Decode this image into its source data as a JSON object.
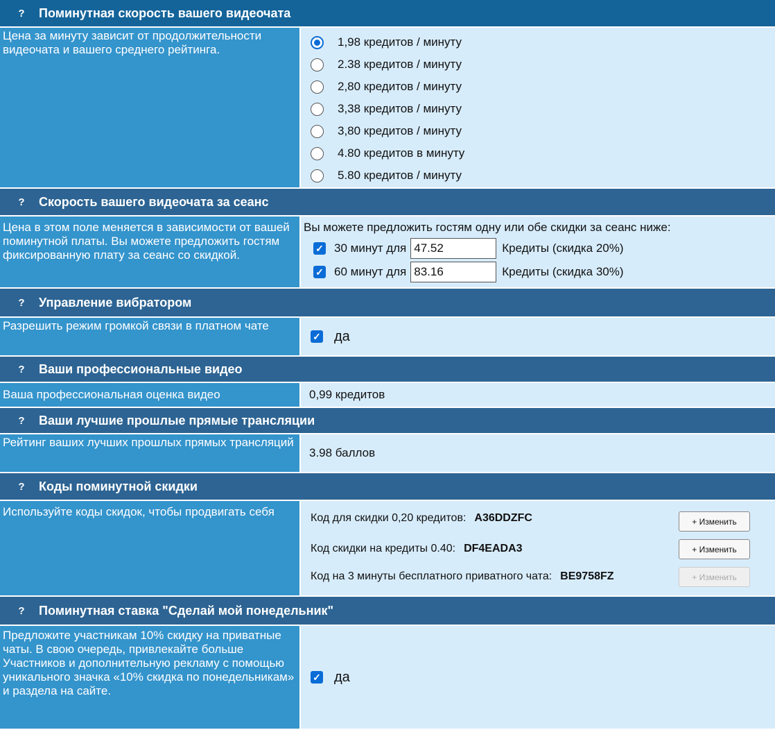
{
  "sections": {
    "rate": {
      "title": "Поминутная скорость вашего видеочата",
      "desc": "Цена за минуту зависит от продолжительности видеочата и вашего среднего рейтинга.",
      "options": [
        "1,98 кредитов / минуту",
        "2.38 кредитов / минуту",
        "2,80 кредитов / минуту",
        "3,38 кредитов / минуту",
        "3,80 кредитов / минуту",
        "4.80 кредитов в минуту",
        "5.80 кредитов / минуту"
      ],
      "selected_index": 0
    },
    "session": {
      "title": "Скорость вашего видеочата за сеанс",
      "desc": "Цена в этом поле меняется в зависимости от вашей поминутной платы. Вы можете предложить гостям фиксированную плату за сеанс со скидкой.",
      "intro": "Вы можете предложить гостям одну или обе скидки за сеанс ниже:",
      "items": [
        {
          "label": "30 минут для",
          "value": "47.52",
          "suffix": "Кредиты (скидка 20%)",
          "checked": true
        },
        {
          "label": "60 минут для",
          "value": "83.16",
          "suffix": "Кредиты (скидка 30%)",
          "checked": true
        }
      ]
    },
    "vibrator": {
      "title": "Управление вибратором",
      "desc": "Разрешить режим громкой связи в платном чате",
      "check_label": "да",
      "checked": true
    },
    "pro_videos": {
      "title": "Ваши профессиональные видео",
      "desc": "Ваша профессиональная оценка видео",
      "value": "0,99 кредитов"
    },
    "best_past": {
      "title": "Ваши лучшие прошлые прямые трансляции",
      "desc": "Рейтинг ваших лучших прошлых прямых трансляций",
      "value": "3.98 баллов"
    },
    "codes": {
      "title": "Коды поминутной скидки",
      "desc": "Используйте коды скидок, чтобы продвигать себя",
      "items": [
        {
          "label": "Код для скидки 0,20 кредитов:",
          "code": "A36DDZFC",
          "button": "+ Изменить",
          "disabled": false
        },
        {
          "label": "Код скидки на кредиты 0.40:",
          "code": "DF4EADA3",
          "button": "+ Изменить",
          "disabled": false
        },
        {
          "label": "Код на 3 минуты бесплатного приватного чата:",
          "code": "BE9758FZ",
          "button": "+ Изменить",
          "disabled": true
        }
      ]
    },
    "monday": {
      "title": "Поминутная ставка \"Сделай мой понедельник\"",
      "desc": "Предложите участникам 10% скидку на приватные чаты. В свою очередь, привлекайте больше Участников и дополнительную рекламу с помощью уникального значка «10% скидка по понедельникам» и раздела на сайте.",
      "check_label": "да",
      "checked": true
    }
  },
  "help_glyph": "?",
  "check_glyph": "✓",
  "colors": {
    "header_bg": "#2d6493",
    "label_bg": "#3494cc",
    "value_bg": "#d7ecfb",
    "accent": "#0a6cd6"
  }
}
